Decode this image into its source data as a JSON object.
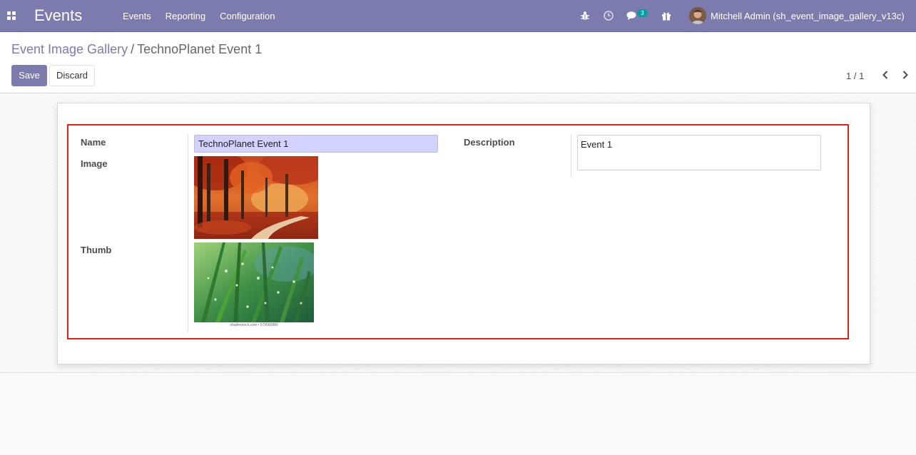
{
  "navbar": {
    "app_title": "Events",
    "menu": [
      "Events",
      "Reporting",
      "Configuration"
    ],
    "message_count": "3",
    "user_name": "Mitchell Admin (sh_event_image_gallery_v13c)"
  },
  "control_panel": {
    "breadcrumb_parent": "Event Image Gallery",
    "breadcrumb_separator": "/",
    "breadcrumb_current": "TechnoPlanet Event 1",
    "save_label": "Save",
    "discard_label": "Discard",
    "pager": "1 / 1"
  },
  "form": {
    "name_label": "Name",
    "name_value": "TechnoPlanet Event 1",
    "image_label": "Image",
    "thumb_label": "Thumb",
    "thumb_credit": "shutterstock.com • 579660880",
    "description_label": "Description",
    "description_value": "Event 1"
  },
  "colors": {
    "brand": "#7c7bad",
    "highlight_border": "#d9201c",
    "badge": "#00a09d",
    "name_input_bg": "#d2d2ff"
  }
}
